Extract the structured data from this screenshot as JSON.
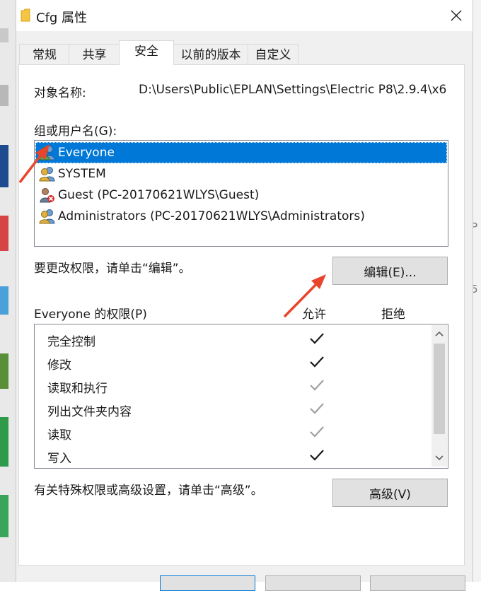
{
  "window": {
    "title": "Cfg 属性",
    "folder_icon": "folder-icon",
    "close_icon": "close-icon"
  },
  "tabs": [
    {
      "label": "常规",
      "active": false
    },
    {
      "label": "共享",
      "active": false
    },
    {
      "label": "安全",
      "active": true
    },
    {
      "label": "以前的版本",
      "active": false
    },
    {
      "label": "自定义",
      "active": false
    }
  ],
  "object": {
    "label": "对象名称:",
    "value": "D:\\Users\\Public\\EPLAN\\Settings\\Electric P8\\2.9.4\\x6"
  },
  "groups": {
    "label": "组或用户名(G):",
    "items": [
      {
        "name": "Everyone",
        "icon": "users-group-icon",
        "selected": true
      },
      {
        "name": "SYSTEM",
        "icon": "users-group-icon",
        "selected": false
      },
      {
        "name": "Guest (PC-20170621WLYS\\Guest)",
        "icon": "user-disabled-icon",
        "selected": false
      },
      {
        "name": "Administrators (PC-20170621WLYS\\Administrators)",
        "icon": "users-group-icon",
        "selected": false
      }
    ]
  },
  "edit": {
    "hint": "要更改权限，请单击“编辑”。",
    "button_label": "编辑(E)..."
  },
  "permissions": {
    "label": "Everyone 的权限(P)",
    "allow_header": "允许",
    "deny_header": "拒绝",
    "rows": [
      {
        "name": "完全控制",
        "allow": "explicit"
      },
      {
        "name": "修改",
        "allow": "explicit"
      },
      {
        "name": "读取和执行",
        "allow": "inherited"
      },
      {
        "name": "列出文件夹内容",
        "allow": "inherited"
      },
      {
        "name": "读取",
        "allow": "inherited"
      },
      {
        "name": "写入",
        "allow": "explicit"
      }
    ]
  },
  "advanced": {
    "hint": "有关特殊权限或高级设置，请单击“高级”。",
    "button_label": "高级(V)"
  },
  "background": {
    "right_fragment_1": "P",
    "right_fragment_2": "5"
  },
  "colors": {
    "selection": "#0078d7",
    "arrow": "#e8452c",
    "check_explicit": "#1a1a1a",
    "check_inherited": "#a0a0a0"
  }
}
